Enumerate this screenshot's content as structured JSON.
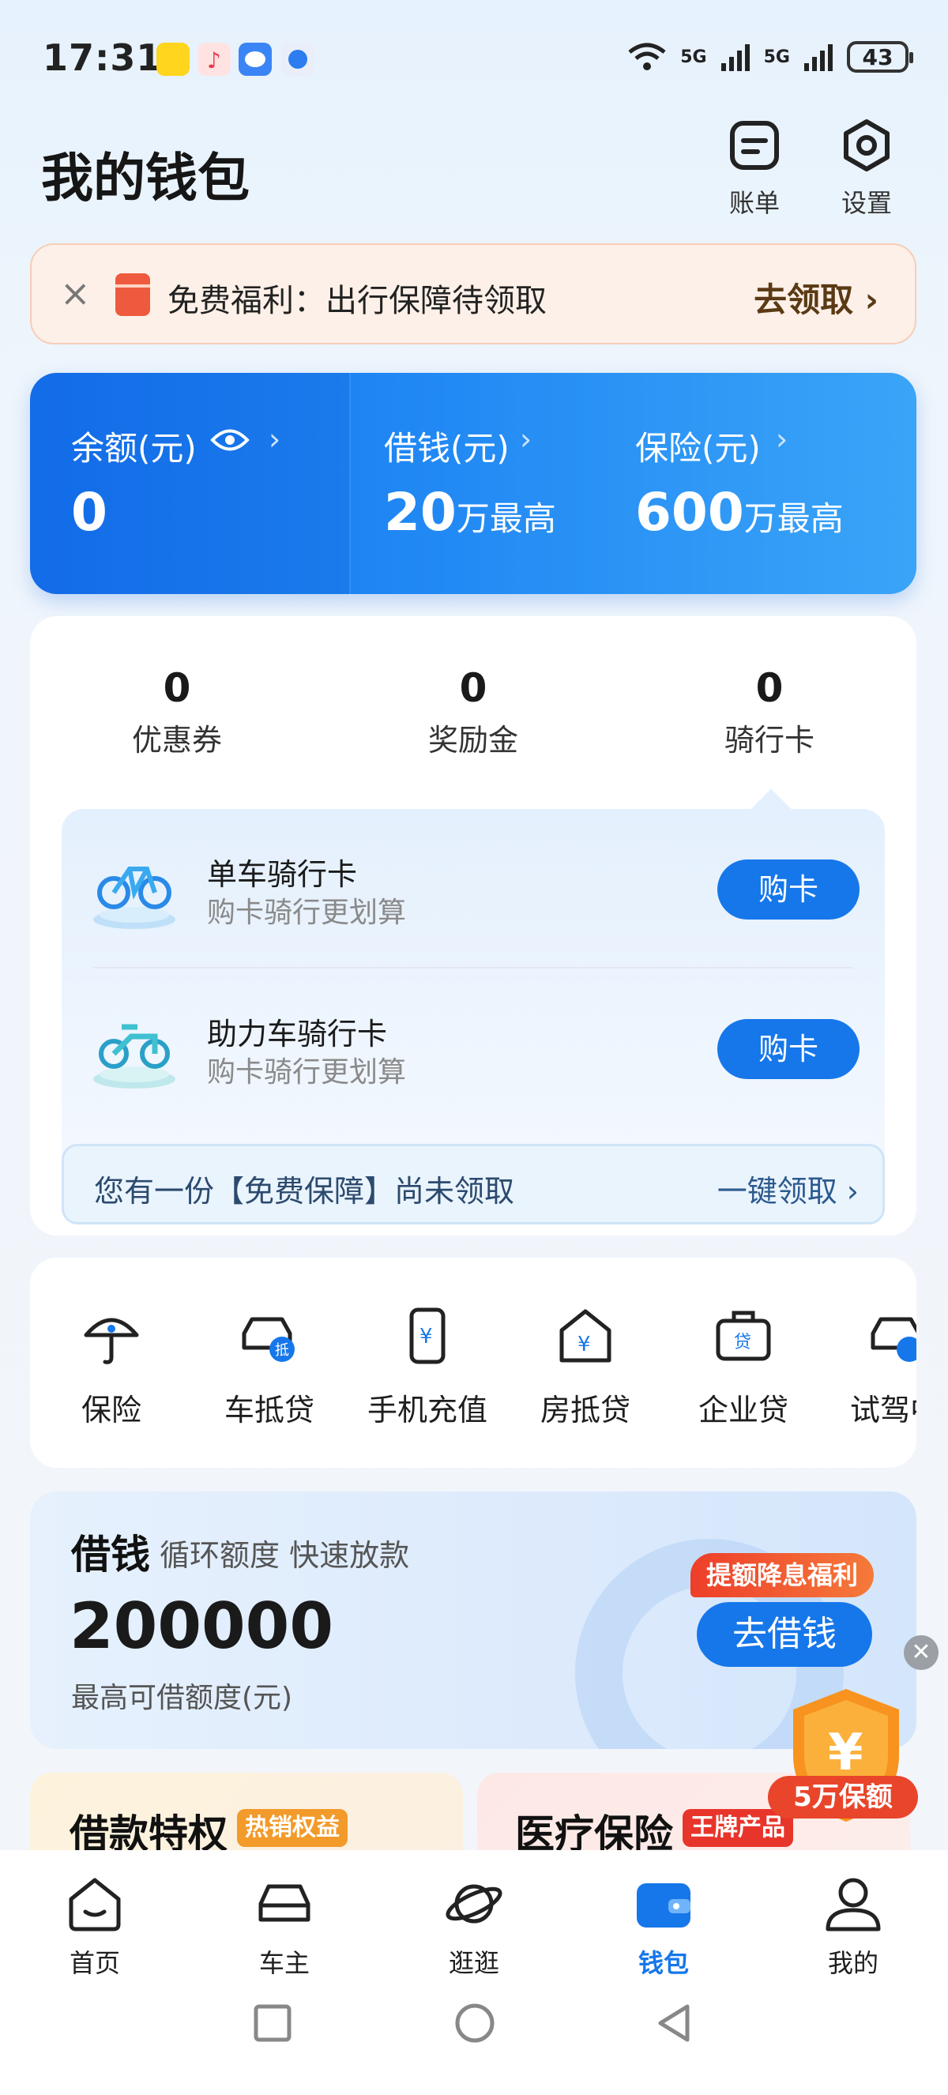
{
  "status_bar": {
    "time": "17:31",
    "net1": "5G",
    "net2": "5G",
    "battery": "43"
  },
  "header": {
    "title": "我的钱包",
    "bill_label": "账单",
    "settings_label": "设置"
  },
  "promo": {
    "text": "免费福利：出行保障待领取",
    "cta": "去领取 ›"
  },
  "summary": {
    "balance_label": "余额(元)",
    "balance_value": "0",
    "borrow_label": "借钱(元)",
    "borrow_value": "20",
    "borrow_unit": "万最高",
    "insurance_label": "保险(元)",
    "insurance_value": "600",
    "insurance_unit": "万最高"
  },
  "counts": [
    {
      "value": "0",
      "label": "优惠券"
    },
    {
      "value": "0",
      "label": "奖励金"
    },
    {
      "value": "0",
      "label": "骑行卡"
    }
  ],
  "ride_cards": [
    {
      "title": "单车骑行卡",
      "subtitle": "购卡骑行更划算",
      "button": "购卡"
    },
    {
      "title": "助力车骑行卡",
      "subtitle": "购卡骑行更划算",
      "button": "购卡"
    }
  ],
  "guarantee": {
    "text": "您有一份【免费保障】尚未领取",
    "cta": "一键领取 ›"
  },
  "services": [
    {
      "label": "保险",
      "icon": "umbrella-icon"
    },
    {
      "label": "车抵贷",
      "icon": "car-loan-icon"
    },
    {
      "label": "手机充值",
      "icon": "phone-recharge-icon"
    },
    {
      "label": "房抵贷",
      "icon": "house-loan-icon"
    },
    {
      "label": "企业贷",
      "icon": "business-loan-icon"
    },
    {
      "label": "试驾中",
      "icon": "test-drive-icon"
    }
  ],
  "borrow": {
    "title": "借钱",
    "tagline": "循环额度 快速放款",
    "amount": "200000",
    "caption": "最高可借额度(元)",
    "badge": "提额降息福利",
    "button": "去借钱"
  },
  "floating": {
    "close": "✕",
    "shield_symbol": "¥",
    "shield_label": "5万保额"
  },
  "tiles": [
    {
      "title": "借款特权",
      "tag": "热销权益"
    },
    {
      "title": "医疗保险",
      "tag": "王牌产品"
    }
  ],
  "tabbar": [
    {
      "label": "首页",
      "icon": "home-icon"
    },
    {
      "label": "车主",
      "icon": "car-icon"
    },
    {
      "label": "逛逛",
      "icon": "planet-icon"
    },
    {
      "label": "钱包",
      "icon": "wallet-icon"
    },
    {
      "label": "我的",
      "icon": "profile-icon"
    }
  ],
  "colors": {
    "accent": "#1677ea",
    "promo_bg": "#fdf0e8",
    "badge_red": "#ee3e2a"
  }
}
